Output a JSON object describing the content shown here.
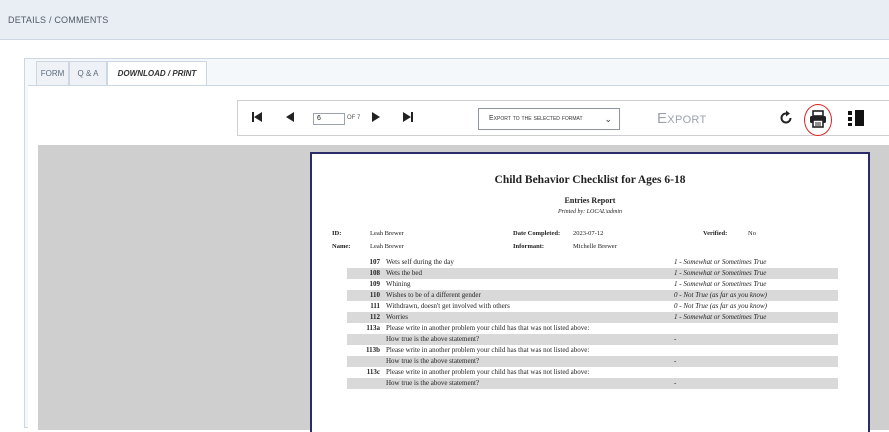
{
  "header": {
    "title": "DETAILS / COMMENTS"
  },
  "tabs": [
    {
      "label": "FORM"
    },
    {
      "label": "Q & A"
    },
    {
      "label": "DOWNLOAD / PRINT"
    }
  ],
  "toolbar": {
    "page_value": "6",
    "page_of": "OF 7",
    "export_select": "Export to the selected format",
    "export_button": "Export"
  },
  "report": {
    "title": "Child Behavior Checklist for Ages 6-18",
    "subtitle": "Entries Report",
    "printed_by": "Printed by: LOCAL\\admin",
    "meta": {
      "id_label": "ID:",
      "id_value": "Leah Brewer",
      "date_label": "Date Completed:",
      "date_value": "2023-07-12",
      "verified_label": "Verified:",
      "verified_value": "No",
      "name_label": "Name:",
      "name_value": "Leah Brewer",
      "informant_label": "Informant:",
      "informant_value": "Michelle Brewer"
    },
    "rows": [
      {
        "num": "107",
        "desc": "Wets self during the day",
        "ans": "1 - Somewhat or Sometimes True"
      },
      {
        "num": "108",
        "desc": "Wets the bed",
        "ans": "1 - Somewhat or Sometimes True"
      },
      {
        "num": "109",
        "desc": "Whining",
        "ans": "1 - Somewhat or Sometimes True"
      },
      {
        "num": "110",
        "desc": "Wishes to be of a different gender",
        "ans": "0 - Not True (as far as you know)"
      },
      {
        "num": "111",
        "desc": "Withdrawn, doesn't get involved with others",
        "ans": "0 - Not True (as far as you know)"
      },
      {
        "num": "112",
        "desc": "Worries",
        "ans": "1 - Somewhat or Sometimes True"
      },
      {
        "num": "113a",
        "desc": "Please write in another problem your child has that was not listed above:",
        "ans": ""
      },
      {
        "num": "",
        "desc": "How true is the above statement?",
        "ans": "-"
      },
      {
        "num": "113b",
        "desc": "Please write in another problem your child has that was not listed above:",
        "ans": ""
      },
      {
        "num": "",
        "desc": "How true is the above statement?",
        "ans": "-"
      },
      {
        "num": "113c",
        "desc": "Please write in another problem your child has that was not listed above:",
        "ans": ""
      },
      {
        "num": "",
        "desc": "How true is the above statement?",
        "ans": "-"
      }
    ]
  },
  "icons": [
    "first-page-icon",
    "previous-page-icon",
    "next-page-icon",
    "last-page-icon",
    "refresh-icon",
    "print-icon",
    "toggle-sidebar-icon"
  ],
  "colors": {
    "highlight_circle": "#e02020",
    "report_border": "#2b2b6a",
    "row_shade": "#d9d9d9"
  }
}
